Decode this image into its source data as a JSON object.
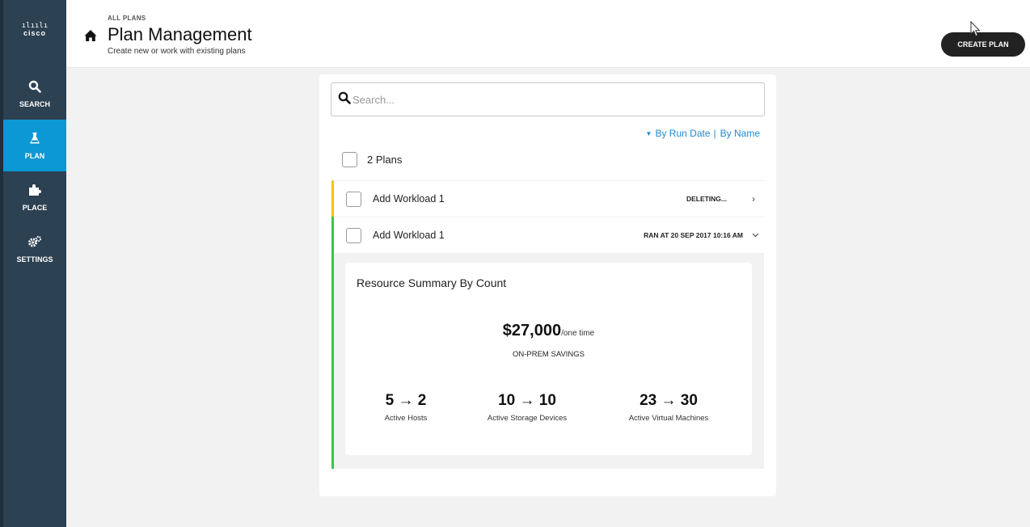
{
  "sidebar": {
    "logo_text": "cisco",
    "items": [
      {
        "label": "SEARCH",
        "icon": "search-icon"
      },
      {
        "label": "PLAN",
        "icon": "flask-icon",
        "active": true
      },
      {
        "label": "PLACE",
        "icon": "puzzle-icon"
      },
      {
        "label": "SETTINGS",
        "icon": "gears-icon"
      }
    ]
  },
  "header": {
    "breadcrumb": "ALL PLANS",
    "title": "Plan Management",
    "subtitle": "Create new or work with existing plans",
    "create_button": "CREATE PLAN"
  },
  "search": {
    "placeholder": "Search..."
  },
  "sort": {
    "by_run_date": "By Run Date",
    "separator": "|",
    "by_name": "By Name"
  },
  "plans_count_label": "2 Plans",
  "plans": [
    {
      "name": "Add Workload 1",
      "status": "DELETING...",
      "accent": "#f4c400"
    },
    {
      "name": "Add Workload 1",
      "status": "RAN AT 20 SEP 2017 10:16 AM",
      "accent": "#3fc14c"
    }
  ],
  "summary": {
    "title": "Resource Summary By Count",
    "savings_amount": "$27,000",
    "savings_unit": "/one time",
    "savings_label": "ON-PREM SAVINGS",
    "metrics": [
      {
        "value": "5 → 2",
        "label": "Active Hosts"
      },
      {
        "value": "10 → 10",
        "label": "Active Storage Devices"
      },
      {
        "value": "23 → 30",
        "label": "Active Virtual Machines"
      }
    ]
  },
  "colors": {
    "sidebar": "#2c4152",
    "active_nav": "#0c98d4",
    "link": "#1f8ad2"
  }
}
